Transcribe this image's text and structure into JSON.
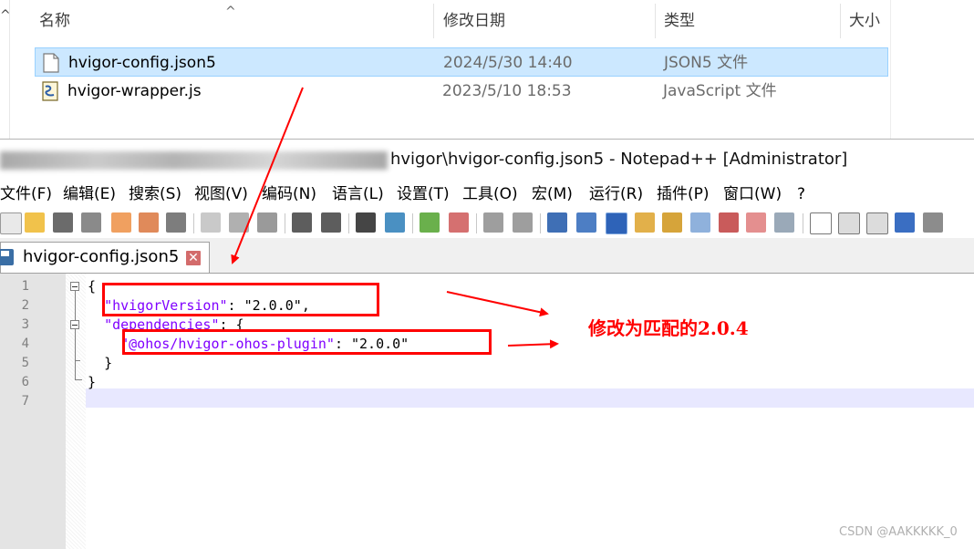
{
  "explorer": {
    "columns": {
      "name": "名称",
      "modified": "修改日期",
      "type": "类型",
      "size": "大小"
    },
    "files": [
      {
        "name": "hvigor-config.json5",
        "modified": "2024/5/30 14:40",
        "type": "JSON5 文件",
        "icon": "document-icon",
        "selected": true
      },
      {
        "name": "hvigor-wrapper.js",
        "modified": "2023/5/10 18:53",
        "type": "JavaScript 文件",
        "icon": "js-script-icon",
        "selected": false
      }
    ]
  },
  "notepad": {
    "title": "hvigor\\hvigor-config.json5 - Notepad++ [Administrator]",
    "menu": [
      "文件(F)",
      "编辑(E)",
      "搜索(S)",
      "视图(V)",
      "编码(N)",
      "语言(L)",
      "设置(T)",
      "工具(O)",
      "宏(M)",
      "运行(R)",
      "插件(P)",
      "窗口(W)",
      "?"
    ],
    "tab": {
      "label": "hvigor-config.json5"
    },
    "line_numbers": [
      "1",
      "2",
      "3",
      "4",
      "5",
      "6",
      "7"
    ],
    "code": {
      "l1": "{",
      "l2_key": "\"hvigorVersion\"",
      "l2_colon": ": ",
      "l2_val": "\"2.0.0\"",
      "l2_comma": ",",
      "l3_key": "\"dependencies\"",
      "l3_rest": ": {",
      "l4_key": "\"@ohos/hvigor-ohos-plugin\"",
      "l4_colon": ": ",
      "l4_val": "\"2.0.0\"",
      "l5": "}",
      "l6": "}"
    }
  },
  "annotation": {
    "text": "修改为匹配的2.0.4",
    "color": "#ff0000"
  },
  "watermark": "CSDN @AAKKKKK_0"
}
